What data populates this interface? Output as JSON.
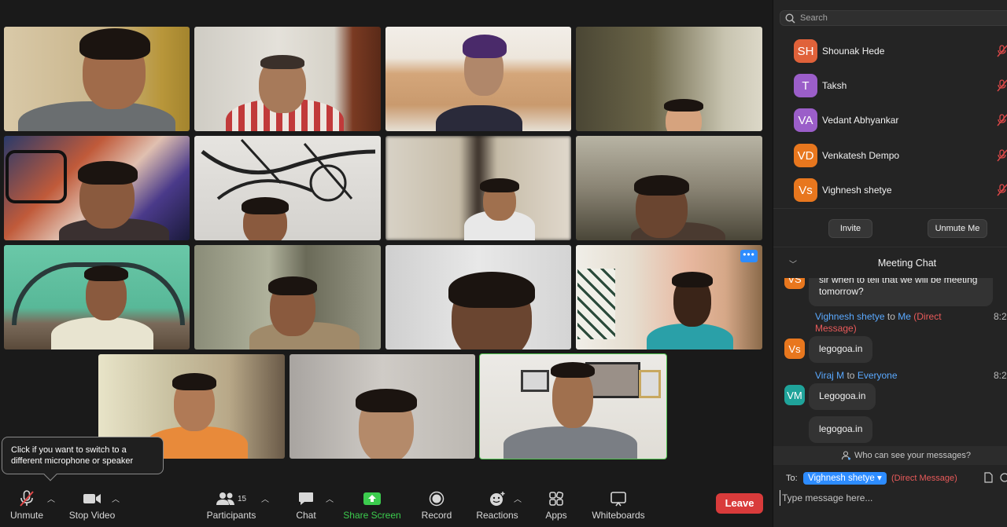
{
  "tooltip": {
    "text_line1": "Click if you want to switch to a",
    "text_line2": "different microphone or speaker"
  },
  "toolbar": {
    "unmute": "Unmute",
    "stop_video": "Stop Video",
    "participants": "Participants",
    "participant_count": "15",
    "chat": "Chat",
    "share_screen": "Share Screen",
    "record": "Record",
    "reactions": "Reactions",
    "apps": "Apps",
    "whiteboards": "Whiteboards",
    "leave": "Leave"
  },
  "panel": {
    "search_placeholder": "Search",
    "participants": [
      {
        "initials": "SH",
        "name": "Shounak Hede",
        "color": "#e0623a"
      },
      {
        "initials": "T",
        "name": "Taksh",
        "color": "#9b5ec9"
      },
      {
        "initials": "VA",
        "name": "Vedant Abhyankar",
        "color": "#9b5ec9"
      },
      {
        "initials": "VD",
        "name": "Venkatesh Dempo",
        "color": "#e8771e"
      },
      {
        "initials": "Vs",
        "name": "Vighnesh shetye",
        "color": "#e8771e"
      }
    ],
    "invite": "Invite",
    "unmute_me": "Unmute Me",
    "chat_title": "Meeting Chat",
    "messages": {
      "m1_line1": "sir when to tell that we will be meeting",
      "m1_line2": "tomorrow?",
      "m1_avatar": "VS",
      "m2_sender": "Vighnesh shetye",
      "m2_to": "to",
      "m2_recipient": "Me",
      "m2_flag_line1": "(Direct",
      "m2_flag_line2": "Message)",
      "m2_time": "8:2",
      "m2_avatar": "Vs",
      "m2_text": "legogoa.in",
      "m3_sender": "Viraj M",
      "m3_to": "to",
      "m3_recipient": "Everyone",
      "m3_time": "8:2",
      "m3_avatar": "VM",
      "m3_text1": "Legogoa.in",
      "m3_text2": "legogoa.in"
    },
    "visibility": "Who can see your messages?",
    "to_label": "To:",
    "recipient": "Vighnesh shetye",
    "direct_flag": "(Direct Message)",
    "compose_placeholder": "Type message here..."
  },
  "colors": {
    "accent": "#2d8cff",
    "leave": "#d93b3b",
    "share": "#3ccc4e",
    "direct": "#e85a5a",
    "link": "#5aa9ff"
  }
}
